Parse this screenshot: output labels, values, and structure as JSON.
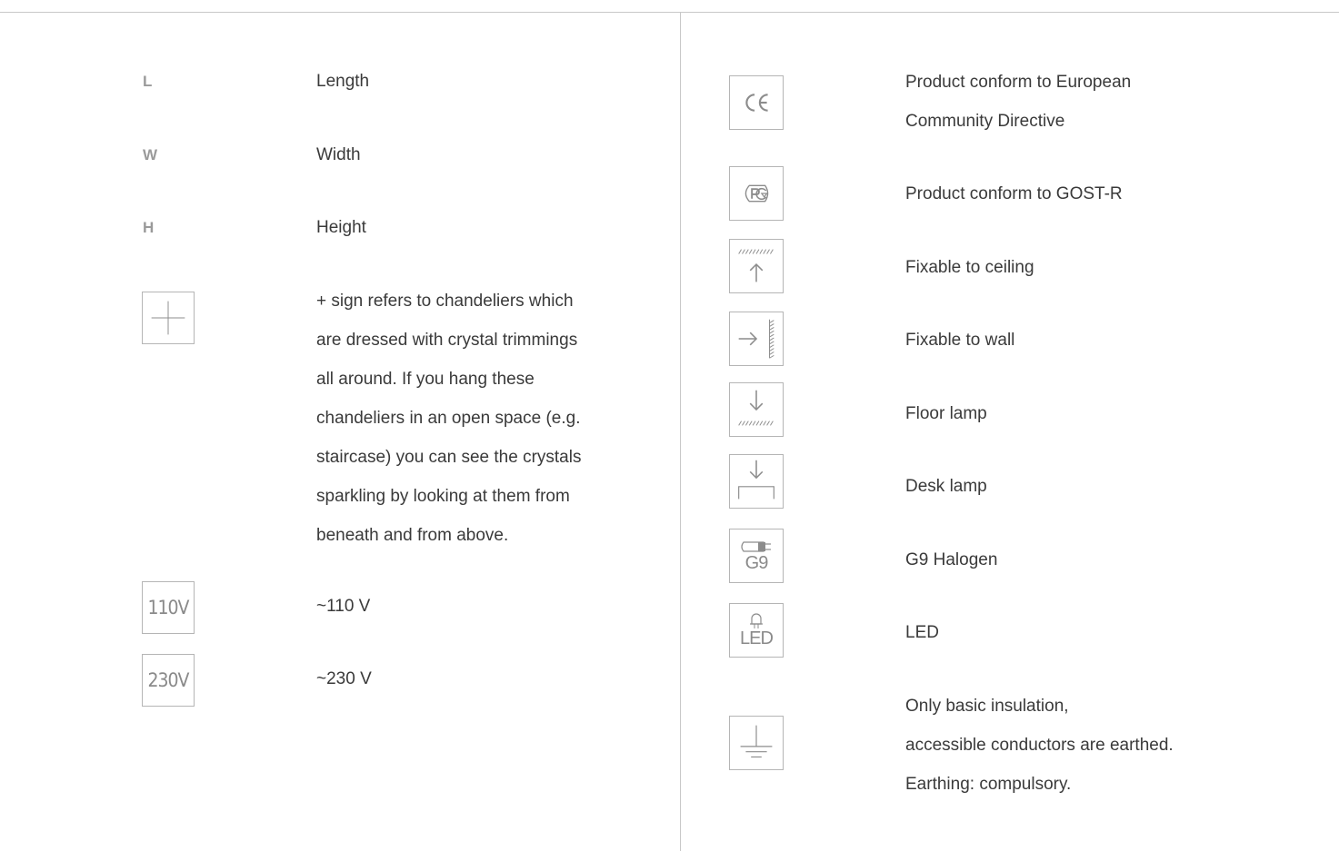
{
  "left": {
    "length": {
      "symbol": "L",
      "label": "Length"
    },
    "width": {
      "symbol": "W",
      "label": "Width"
    },
    "height": {
      "symbol": "H",
      "label": "Height"
    },
    "plus_sign": {
      "icon": "plus-icon",
      "description_lines": [
        "+ sign refers to chandeliers which",
        "are dressed with crystal trimmings",
        "all around. If you hang these",
        "chandeliers in an open space (e.g.",
        "staircase) you can see the crystals",
        "sparkling by looking at them from",
        "beneath and from above."
      ]
    },
    "v110": {
      "icon_text": "110V",
      "label": "~110 V"
    },
    "v230": {
      "icon_text": "230V",
      "label": "~230 V"
    }
  },
  "right": {
    "ce": {
      "icon": "ce-mark-icon",
      "label_lines": [
        "Product conform to European",
        "Community Directive"
      ]
    },
    "gost": {
      "icon": "gost-r-mark-icon",
      "label": "Product conform to GOST-R"
    },
    "ceiling": {
      "icon": "ceiling-mount-icon",
      "label": "Fixable to ceiling"
    },
    "wall": {
      "icon": "wall-mount-icon",
      "label": "Fixable to wall"
    },
    "floor": {
      "icon": "floor-lamp-icon",
      "label": "Floor lamp"
    },
    "desk": {
      "icon": "desk-lamp-icon",
      "label": "Desk lamp"
    },
    "g9": {
      "icon": "g9-bulb-icon",
      "icon_text": "G9",
      "label": "G9 Halogen"
    },
    "led": {
      "icon": "led-icon",
      "icon_text": "LED",
      "label": "LED"
    },
    "earth": {
      "icon": "earth-ground-icon",
      "label_lines": [
        "Only basic insulation,",
        "accessible conductors are earthed.",
        "Earthing: compulsory."
      ]
    }
  },
  "colors": {
    "text": "#3a3a3a",
    "icon": "#8c8c8c",
    "rule": "#c8c8c8"
  }
}
